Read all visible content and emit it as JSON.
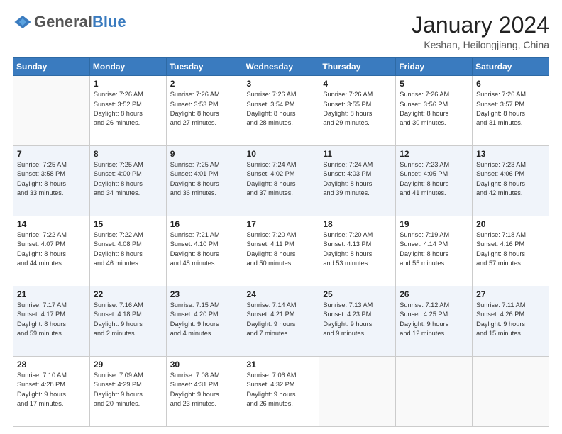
{
  "header": {
    "logo_general": "General",
    "logo_blue": "Blue",
    "month_year": "January 2024",
    "location": "Keshan, Heilongjiang, China"
  },
  "days_of_week": [
    "Sunday",
    "Monday",
    "Tuesday",
    "Wednesday",
    "Thursday",
    "Friday",
    "Saturday"
  ],
  "weeks": [
    {
      "row_style": "row-white",
      "days": [
        {
          "num": "",
          "content": ""
        },
        {
          "num": "1",
          "content": "Sunrise: 7:26 AM\nSunset: 3:52 PM\nDaylight: 8 hours\nand 26 minutes."
        },
        {
          "num": "2",
          "content": "Sunrise: 7:26 AM\nSunset: 3:53 PM\nDaylight: 8 hours\nand 27 minutes."
        },
        {
          "num": "3",
          "content": "Sunrise: 7:26 AM\nSunset: 3:54 PM\nDaylight: 8 hours\nand 28 minutes."
        },
        {
          "num": "4",
          "content": "Sunrise: 7:26 AM\nSunset: 3:55 PM\nDaylight: 8 hours\nand 29 minutes."
        },
        {
          "num": "5",
          "content": "Sunrise: 7:26 AM\nSunset: 3:56 PM\nDaylight: 8 hours\nand 30 minutes."
        },
        {
          "num": "6",
          "content": "Sunrise: 7:26 AM\nSunset: 3:57 PM\nDaylight: 8 hours\nand 31 minutes."
        }
      ]
    },
    {
      "row_style": "row-alt",
      "days": [
        {
          "num": "7",
          "content": "Sunrise: 7:25 AM\nSunset: 3:58 PM\nDaylight: 8 hours\nand 33 minutes."
        },
        {
          "num": "8",
          "content": "Sunrise: 7:25 AM\nSunset: 4:00 PM\nDaylight: 8 hours\nand 34 minutes."
        },
        {
          "num": "9",
          "content": "Sunrise: 7:25 AM\nSunset: 4:01 PM\nDaylight: 8 hours\nand 36 minutes."
        },
        {
          "num": "10",
          "content": "Sunrise: 7:24 AM\nSunset: 4:02 PM\nDaylight: 8 hours\nand 37 minutes."
        },
        {
          "num": "11",
          "content": "Sunrise: 7:24 AM\nSunset: 4:03 PM\nDaylight: 8 hours\nand 39 minutes."
        },
        {
          "num": "12",
          "content": "Sunrise: 7:23 AM\nSunset: 4:05 PM\nDaylight: 8 hours\nand 41 minutes."
        },
        {
          "num": "13",
          "content": "Sunrise: 7:23 AM\nSunset: 4:06 PM\nDaylight: 8 hours\nand 42 minutes."
        }
      ]
    },
    {
      "row_style": "row-white",
      "days": [
        {
          "num": "14",
          "content": "Sunrise: 7:22 AM\nSunset: 4:07 PM\nDaylight: 8 hours\nand 44 minutes."
        },
        {
          "num": "15",
          "content": "Sunrise: 7:22 AM\nSunset: 4:08 PM\nDaylight: 8 hours\nand 46 minutes."
        },
        {
          "num": "16",
          "content": "Sunrise: 7:21 AM\nSunset: 4:10 PM\nDaylight: 8 hours\nand 48 minutes."
        },
        {
          "num": "17",
          "content": "Sunrise: 7:20 AM\nSunset: 4:11 PM\nDaylight: 8 hours\nand 50 minutes."
        },
        {
          "num": "18",
          "content": "Sunrise: 7:20 AM\nSunset: 4:13 PM\nDaylight: 8 hours\nand 53 minutes."
        },
        {
          "num": "19",
          "content": "Sunrise: 7:19 AM\nSunset: 4:14 PM\nDaylight: 8 hours\nand 55 minutes."
        },
        {
          "num": "20",
          "content": "Sunrise: 7:18 AM\nSunset: 4:16 PM\nDaylight: 8 hours\nand 57 minutes."
        }
      ]
    },
    {
      "row_style": "row-alt",
      "days": [
        {
          "num": "21",
          "content": "Sunrise: 7:17 AM\nSunset: 4:17 PM\nDaylight: 8 hours\nand 59 minutes."
        },
        {
          "num": "22",
          "content": "Sunrise: 7:16 AM\nSunset: 4:18 PM\nDaylight: 9 hours\nand 2 minutes."
        },
        {
          "num": "23",
          "content": "Sunrise: 7:15 AM\nSunset: 4:20 PM\nDaylight: 9 hours\nand 4 minutes."
        },
        {
          "num": "24",
          "content": "Sunrise: 7:14 AM\nSunset: 4:21 PM\nDaylight: 9 hours\nand 7 minutes."
        },
        {
          "num": "25",
          "content": "Sunrise: 7:13 AM\nSunset: 4:23 PM\nDaylight: 9 hours\nand 9 minutes."
        },
        {
          "num": "26",
          "content": "Sunrise: 7:12 AM\nSunset: 4:25 PM\nDaylight: 9 hours\nand 12 minutes."
        },
        {
          "num": "27",
          "content": "Sunrise: 7:11 AM\nSunset: 4:26 PM\nDaylight: 9 hours\nand 15 minutes."
        }
      ]
    },
    {
      "row_style": "row-white",
      "days": [
        {
          "num": "28",
          "content": "Sunrise: 7:10 AM\nSunset: 4:28 PM\nDaylight: 9 hours\nand 17 minutes."
        },
        {
          "num": "29",
          "content": "Sunrise: 7:09 AM\nSunset: 4:29 PM\nDaylight: 9 hours\nand 20 minutes."
        },
        {
          "num": "30",
          "content": "Sunrise: 7:08 AM\nSunset: 4:31 PM\nDaylight: 9 hours\nand 23 minutes."
        },
        {
          "num": "31",
          "content": "Sunrise: 7:06 AM\nSunset: 4:32 PM\nDaylight: 9 hours\nand 26 minutes."
        },
        {
          "num": "",
          "content": ""
        },
        {
          "num": "",
          "content": ""
        },
        {
          "num": "",
          "content": ""
        }
      ]
    }
  ]
}
